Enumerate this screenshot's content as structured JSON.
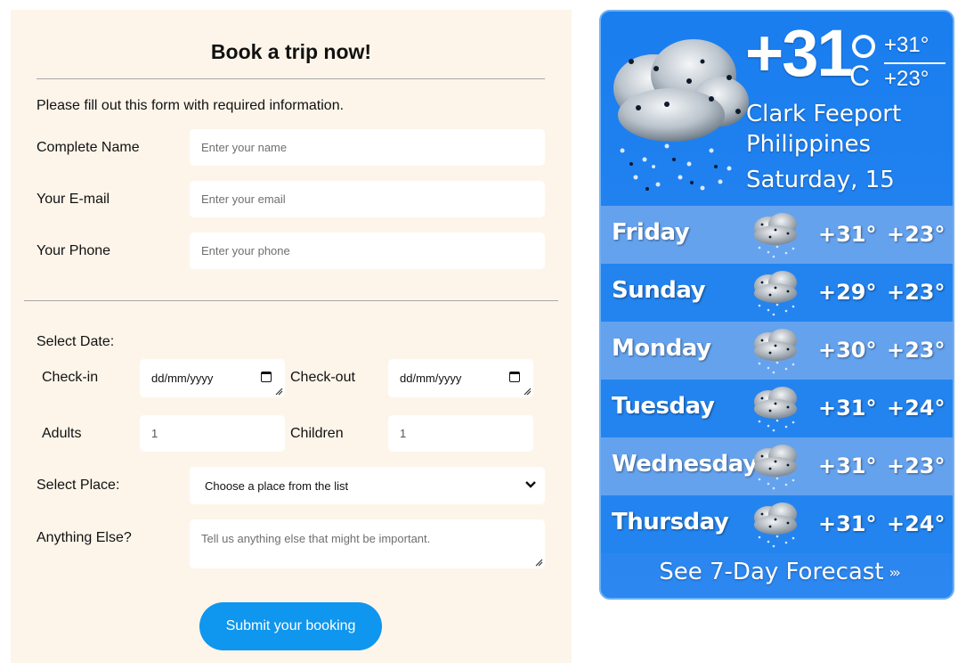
{
  "form": {
    "title": "Book a trip now!",
    "intro": "Please fill out this form with required information.",
    "name_label": "Complete Name",
    "name_placeholder": "Enter your name",
    "email_label": "Your E-mail",
    "email_placeholder": "Enter your email",
    "phone_label": "Your Phone",
    "phone_placeholder": "Enter your phone",
    "select_date_label": "Select Date:",
    "checkin_label": "Check-in",
    "checkin_value": "dd/mm/yyyy",
    "checkout_label": "Check-out",
    "checkout_value": "dd/mm/yyyy",
    "adults_label": "Adults",
    "adults_value": "1",
    "children_label": "Children",
    "children_value": "1",
    "place_label": "Select Place:",
    "place_value": "Choose a place from the list",
    "else_label": "Anything Else?",
    "else_placeholder": "Tell us anything else that might be important.",
    "submit_label": "Submit your booking"
  },
  "weather": {
    "temp_sign_value": "+31",
    "unit": "C",
    "hi": "+31°",
    "lo": "+23°",
    "city": "Clark Feeport",
    "country": "Philippines",
    "today": "Saturday, 15",
    "condition_icon": "rain-cloud-icon",
    "days": [
      {
        "name": "Friday",
        "hi": "+31°",
        "lo": "+23°"
      },
      {
        "name": "Sunday",
        "hi": "+29°",
        "lo": "+23°"
      },
      {
        "name": "Monday",
        "hi": "+30°",
        "lo": "+23°"
      },
      {
        "name": "Tuesday",
        "hi": "+31°",
        "lo": "+24°"
      },
      {
        "name": "Wednesday",
        "hi": "+31°",
        "lo": "+23°"
      },
      {
        "name": "Thursday",
        "hi": "+31°",
        "lo": "+24°"
      }
    ],
    "see_more": "See 7-Day Forecast",
    "see_more_arrows": "›››"
  },
  "colors": {
    "form_bg": "#fdf5ea",
    "submit_bg": "#0f96ee",
    "weather_bg": "#1a7eef",
    "weather_row_alt": "#65a2ee"
  }
}
